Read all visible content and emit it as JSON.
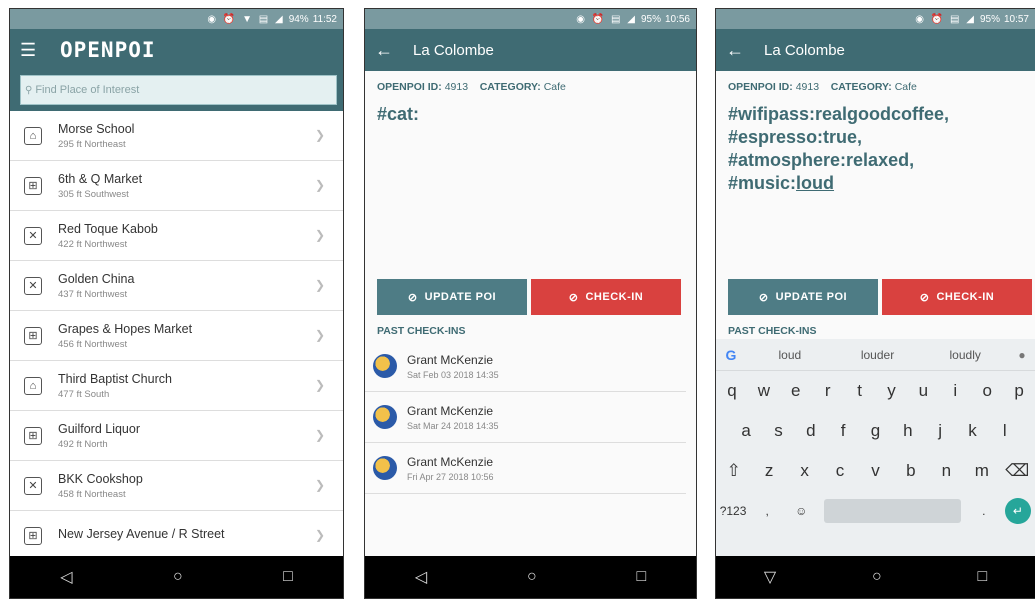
{
  "screen1": {
    "status": {
      "icons": "◉ ⏰ ▼ ▤ ◢",
      "battery": "94%",
      "time": "11:52"
    },
    "app_title": "OPENPOI",
    "search_placeholder": "Find Place of Interest",
    "items": [
      {
        "name": "Morse School",
        "dist": "295 ft Northeast",
        "icon": "school-icon",
        "glyph": "⌂"
      },
      {
        "name": "6th & Q Market",
        "dist": "305 ft Southwest",
        "icon": "cart-icon",
        "glyph": "⊞"
      },
      {
        "name": "Red Toque Kabob",
        "dist": "422 ft Northwest",
        "icon": "restaurant-icon",
        "glyph": "✕"
      },
      {
        "name": "Golden China",
        "dist": "437 ft Northwest",
        "icon": "restaurant-icon",
        "glyph": "✕"
      },
      {
        "name": "Grapes & Hopes Market",
        "dist": "456 ft Northwest",
        "icon": "cart-icon",
        "glyph": "⊞"
      },
      {
        "name": "Third Baptist Church",
        "dist": "477 ft South",
        "icon": "church-icon",
        "glyph": "⌂"
      },
      {
        "name": "Guilford Liquor",
        "dist": "492 ft North",
        "icon": "cart-icon",
        "glyph": "⊞"
      },
      {
        "name": "BKK Cookshop",
        "dist": "458 ft Northeast",
        "icon": "restaurant-icon",
        "glyph": "✕"
      },
      {
        "name": "New Jersey Avenue / R Street",
        "dist": "",
        "icon": "cart-icon",
        "glyph": "⊞"
      }
    ]
  },
  "screen2": {
    "status": {
      "icons": "◉ ⏰ ▤ ◢",
      "battery": "95%",
      "time": "10:56"
    },
    "title": "La Colombe",
    "poi_id_label": "OPENPOI ID:",
    "poi_id": "4913",
    "category_label": "CATEGORY:",
    "category": "Cafe",
    "tags": "#cat:",
    "update_label": "UPDATE POI",
    "checkin_label": "CHECK-IN",
    "past_label": "PAST CHECK-INS",
    "checkins": [
      {
        "name": "Grant McKenzie",
        "date": "Sat Feb 03 2018 14:35"
      },
      {
        "name": "Grant McKenzie",
        "date": "Sat Mar 24 2018 14:35"
      },
      {
        "name": "Grant McKenzie",
        "date": "Fri Apr 27 2018 10:56"
      }
    ]
  },
  "screen3": {
    "status": {
      "icons": "◉ ⏰ ▤ ◢",
      "battery": "95%",
      "time": "10:57"
    },
    "title": "La Colombe",
    "poi_id_label": "OPENPOI ID:",
    "poi_id": "4913",
    "category_label": "CATEGORY:",
    "category": "Cafe",
    "tag_lines": [
      "#wifipass:realgoodcoffee,",
      "#espresso:true,",
      "#atmosphere:relaxed,"
    ],
    "tag_last_prefix": "#music:",
    "tag_last_value": "loud",
    "update_label": "UPDATE POI",
    "checkin_label": "CHECK-IN",
    "past_label": "PAST CHECK-INS",
    "suggestions": [
      "loud",
      "louder",
      "loudly"
    ],
    "row1": [
      "q",
      "w",
      "e",
      "r",
      "t",
      "y",
      "u",
      "i",
      "o",
      "p"
    ],
    "row2": [
      "a",
      "s",
      "d",
      "f",
      "g",
      "h",
      "j",
      "k",
      "l"
    ],
    "row3": [
      "⇧",
      "z",
      "x",
      "c",
      "v",
      "b",
      "n",
      "m",
      "⌫"
    ],
    "sym_label": "?123",
    "comma": ",",
    "emoji": "☺",
    "period": "."
  },
  "nav": {
    "back": "◁",
    "home": "○",
    "recents": "□",
    "down": "▽"
  }
}
